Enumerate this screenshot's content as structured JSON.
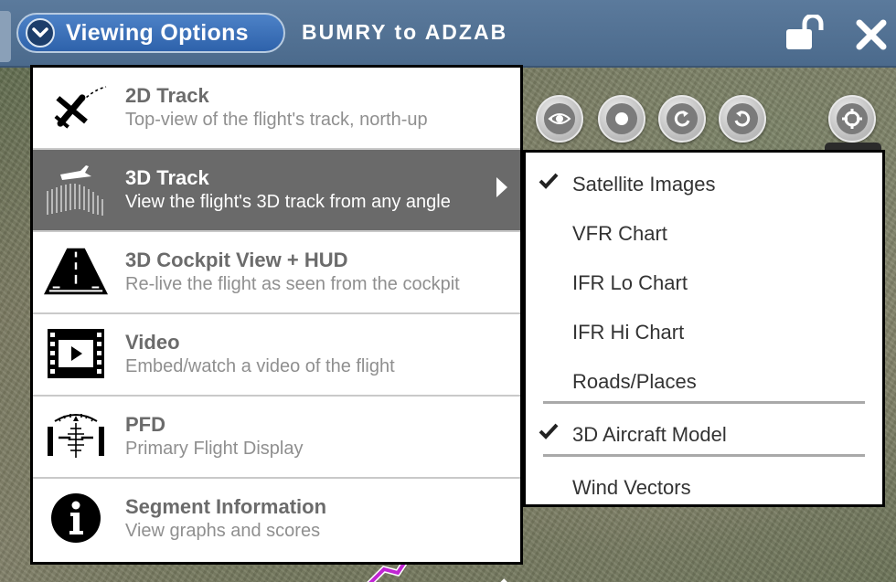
{
  "header": {
    "viewing_options_label": "Viewing Options",
    "route_title": "BUMRY to ADZAB"
  },
  "menu": {
    "items": [
      {
        "title": "2D Track",
        "subtitle": "Top-view of the flight's track, north-up",
        "icon": "plane-track-icon"
      },
      {
        "title": "3D Track",
        "subtitle": "View the flight's 3D track from any angle",
        "icon": "3d-track-icon",
        "selected": true
      },
      {
        "title": "3D Cockpit View + HUD",
        "subtitle": "Re-live the flight as seen from the cockpit",
        "icon": "runway-icon"
      },
      {
        "title": "Video",
        "subtitle": "Embed/watch a video of the flight",
        "icon": "film-icon"
      },
      {
        "title": "PFD",
        "subtitle": "Primary Flight Display",
        "icon": "pfd-icon"
      },
      {
        "title": "Segment Information",
        "subtitle": "View graphs and scores",
        "icon": "info-icon"
      }
    ]
  },
  "submenu": {
    "items": [
      {
        "label": "Satellite Images",
        "checked": true
      },
      {
        "label": "VFR Chart",
        "checked": false
      },
      {
        "label": "IFR Lo Chart",
        "checked": false
      },
      {
        "label": "IFR Hi Chart",
        "checked": false
      },
      {
        "label": "Roads/Places",
        "checked": false
      },
      {
        "label": "3D Aircraft Model",
        "checked": true
      },
      {
        "label": "Wind Vectors",
        "checked": false
      }
    ]
  },
  "controls": [
    {
      "icon": "eye-toggle-icon"
    },
    {
      "icon": "center-dot-icon"
    },
    {
      "icon": "rotate-cw-icon"
    },
    {
      "icon": "rotate-ccw-icon"
    },
    {
      "icon": "recenter-icon"
    }
  ],
  "colors": {
    "topbar": "#4b6a8c",
    "button_blue": "#2e62ab",
    "selected_row": "#6a6a6a",
    "flight_path": "#c026d3"
  }
}
